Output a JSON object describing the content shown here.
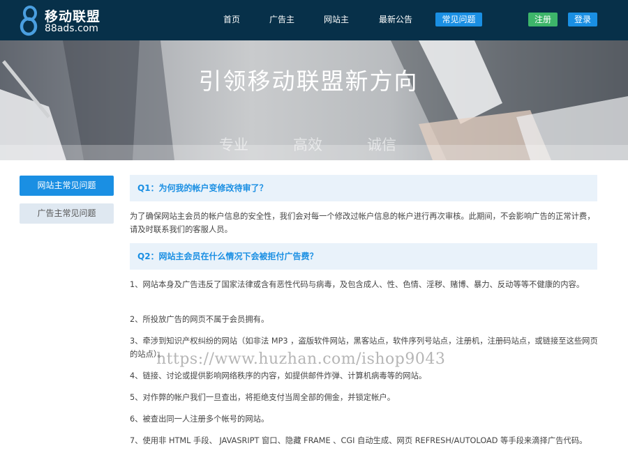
{
  "header": {
    "logo": {
      "mark": "8",
      "title": "移动联盟",
      "domain": "88ads.com"
    },
    "nav": [
      {
        "label": "首页",
        "active": false
      },
      {
        "label": "广告主",
        "active": false
      },
      {
        "label": "网站主",
        "active": false
      },
      {
        "label": "最新公告",
        "active": false
      },
      {
        "label": "常见问题",
        "active": true
      }
    ],
    "register_label": "注册",
    "login_label": "登录"
  },
  "banner": {
    "title": "引领移动联盟新方向",
    "words": [
      "专业",
      "高效",
      "诚信"
    ]
  },
  "sidebar": {
    "items": [
      {
        "label": "网站主常见问题",
        "active": true
      },
      {
        "label": "广告主常见问题",
        "active": false
      }
    ]
  },
  "faq": [
    {
      "question": "Q1：为何我的帐户变修改待审了？",
      "paragraphs": [
        "为了确保网站主会员的帐户信息的安全性，我们会对每一个修改过帐户信息的帐户进行再次审核。此期间，不会影响广告的正常计费，请及时联系我们的客服人员。"
      ]
    },
    {
      "question": "Q2：网站主会员在什么情况下会被拒付广告费？",
      "paragraphs": [
        "1、网站本身及广告违反了国家法律或含有恶性代码与病毒，及包含成人、性、色情、淫秽、赌博、暴力、反动等等不健康的内容。",
        "2、所投放广告的网页不属于会员拥有。",
        "3、牵涉到知识产权纠纷的网站（如非法 MP3 ，盗版软件网站，黑客站点，软件序列号站点，注册机，注册码站点，或链接至这些网页的站点）。",
        "4、链接、讨论或提供影响网络秩序的内容，如提供邮件炸弹、计算机病毒等的网站。",
        "5、对作弊的帐户我们一旦查出，将拒绝支付当周全部的佣金，并锁定帐户。",
        "6、被查出同一人注册多个帐号的网站。",
        "7、使用非 HTML 手段、 JAVASRIPT 窗口、隐藏 FRAME 、CGI 自动生成、网页 REFRESH/AUTOLOAD 等手段来滴择广告代码。"
      ]
    }
  ],
  "watermark": "https://www.huzhan.com/ishop9043",
  "colors": {
    "header_bg": "#073049",
    "accent": "#1a8fe3",
    "register": "#3db56a",
    "question_bg": "#e9f2fa"
  }
}
